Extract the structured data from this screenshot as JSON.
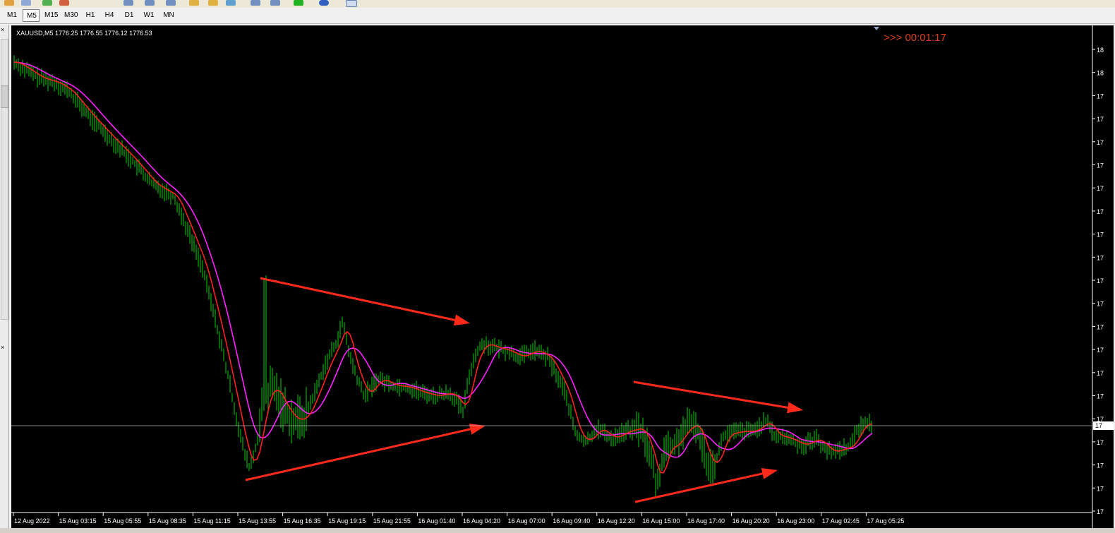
{
  "timeframes": [
    "M1",
    "M5",
    "M15",
    "M30",
    "H1",
    "H4",
    "D1",
    "W1",
    "MN"
  ],
  "active_timeframe": "M5",
  "chart": {
    "symbol_info": "XAUUSD,M5  1776.25 1776.55 1776.12 1776.53",
    "timer": ">>> 00:01:17",
    "current_price_label": "17"
  },
  "side": {
    "close_icon_1": "×",
    "close_icon_2": "×"
  },
  "colors": {
    "background": "#000000",
    "bars": "#00b000",
    "ma_fast": "#ff2020",
    "ma_slow": "#ff20ff",
    "arrows": "#ff2a1a",
    "timer": "#e03c1c",
    "axis_text": "#ffffff",
    "price_line": "#b0b0b0"
  },
  "chart_data": {
    "type": "bar",
    "symbol": "XAUUSD",
    "timeframe": "M5",
    "x_tick_labels": [
      "12 Aug 2022",
      "15 Aug 03:15",
      "15 Aug 05:55",
      "15 Aug 08:35",
      "15 Aug 11:15",
      "15 Aug 13:55",
      "15 Aug 16:35",
      "15 Aug 19:15",
      "15 Aug 21:55",
      "16 Aug 01:40",
      "16 Aug 04:20",
      "16 Aug 07:00",
      "16 Aug 09:40",
      "16 Aug 12:20",
      "16 Aug 15:00",
      "16 Aug 17:40",
      "16 Aug 20:20",
      "16 Aug 23:00",
      "17 Aug 02:45",
      "17 Aug 05:25"
    ],
    "y_tick_labels": [
      "18",
      "18",
      "17",
      "17",
      "17",
      "17",
      "17",
      "17",
      "17",
      "17",
      "17",
      "17",
      "17",
      "17",
      "17",
      "17",
      "17",
      "17",
      "17",
      "17",
      "17"
    ],
    "last_bar": {
      "open": 1776.25,
      "high": 1776.55,
      "low": 1776.12,
      "close": 1776.53
    }
  }
}
